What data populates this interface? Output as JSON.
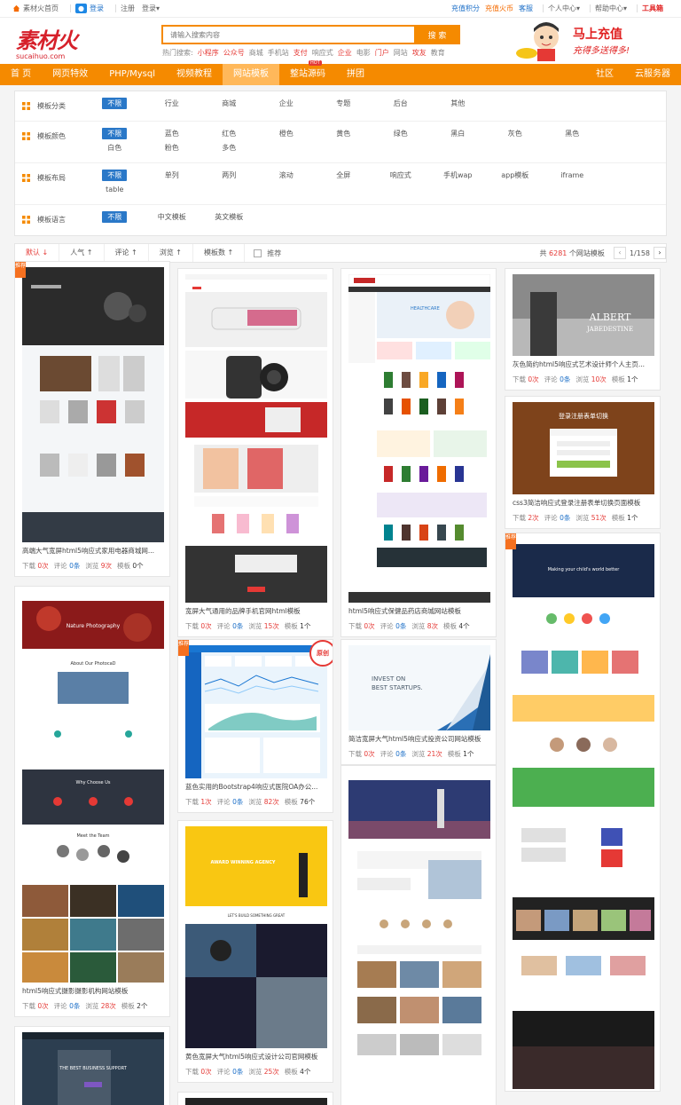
{
  "topbar": {
    "home": "素材火首页",
    "login": "登录",
    "register": "注册",
    "login_menu": "登录",
    "recharge_points": "充值积分",
    "recharge_fire": "充值火币",
    "vip": "客服",
    "personal": "个人中心",
    "help": "帮助中心",
    "tools": "工具箱"
  },
  "header": {
    "logo": "素材火",
    "logo_sub": "sucaihuo.com",
    "search_placeholder": "请输入搜索内容",
    "search_button": "搜 索",
    "hot_label": "热门搜索:",
    "hot": [
      "小程序",
      "公众号",
      "商城",
      "手机站",
      "支付",
      "响应式",
      "企业",
      "电影",
      "门户",
      "网站",
      "攻友",
      "教育"
    ],
    "promo_line1": "马上充值",
    "promo_line2": "充得多送得多!"
  },
  "nav": {
    "items": [
      "首 页",
      "网页特效",
      "PHP/Mysql",
      "视频教程",
      "网站模板",
      "整站源码",
      "拼团"
    ],
    "right": [
      "社区",
      "云服务器"
    ],
    "hot_tag": "HOT"
  },
  "filters": [
    {
      "label": "模板分类",
      "options": [
        "不限",
        "行业",
        "商城",
        "企业",
        "专题",
        "后台",
        "其他"
      ]
    },
    {
      "label": "模板颜色",
      "options": [
        "不限",
        "蓝色",
        "红色",
        "橙色",
        "黄色",
        "绿色",
        "黑白",
        "灰色",
        "黑色",
        "白色",
        "粉色",
        "多色"
      ]
    },
    {
      "label": "模板布局",
      "options": [
        "不限",
        "单列",
        "两列",
        "滚动",
        "全屏",
        "响应式",
        "手机wap",
        "app模板",
        "iframe",
        "table"
      ]
    },
    {
      "label": "模板语言",
      "options": [
        "不限",
        "中文模板",
        "英文模板"
      ]
    }
  ],
  "sortbar": {
    "items": [
      "默认",
      "人气",
      "评论",
      "浏览",
      "模板数"
    ],
    "recommend": "推荐",
    "total_prefix": "共",
    "total": "6281",
    "total_suffix": "个网站模板",
    "page": "1/158"
  },
  "cards": [
    {
      "title": "高端大气宽屏html5响应式家用电器商城网...",
      "down": "0次",
      "comment": "0条",
      "view": "9次",
      "tpl": "0个",
      "badge": "推荐"
    },
    {
      "title": "宽屏大气通用的品牌手机官网html模板",
      "down": "0次",
      "comment": "0条",
      "view": "15次",
      "tpl": "1个"
    },
    {
      "title": "html5响应式保健品药店商城网站模板",
      "down": "0次",
      "comment": "0条",
      "view": "8次",
      "tpl": "4个"
    },
    {
      "title": "灰色简约html5响应式艺术设计师个人主页...",
      "down": "0次",
      "comment": "0条",
      "view": "10次",
      "tpl": "1个"
    },
    {
      "title": "css3简洁响应式登录注册表单切换页面模板",
      "down": "2次",
      "comment": "0条",
      "view": "51次",
      "tpl": "1个"
    },
    {
      "title": "html5响应式摄影摄影机构网站模板",
      "down": "0次",
      "comment": "0条",
      "view": "28次",
      "tpl": "2个"
    },
    {
      "title": "蓝色实用的Bootstrap4响应式医院OA办公...",
      "down": "1次",
      "comment": "0条",
      "view": "82次",
      "tpl": "76个",
      "badge": "推荐",
      "badge2": "原创"
    },
    {
      "title": "简洁宽屏大气html5响应式投资公司网站模板",
      "down": "0次",
      "comment": "0条",
      "view": "21次",
      "tpl": "1个"
    },
    {
      "title": "黄色宽屏大气html5响应式设计公司官网模板",
      "down": "0次",
      "comment": "0条",
      "view": "25次",
      "tpl": "4个"
    }
  ],
  "stats_labels": {
    "down": "下载",
    "comment": "评论",
    "view": "浏览",
    "tpl": "模板"
  },
  "thumbs": {
    "albert": "ALBERT",
    "albert_sub": "JABEDESTINE",
    "login_title": "登录注册表单切换",
    "invest1": "INVEST ON",
    "invest2": "BEST STARTUPS.",
    "award": "AWARD WINNING AGENCY",
    "nature": "Nature Photography",
    "about": "About Our PhotocaD",
    "why": "Why Choose Us",
    "team": "Meet the Team",
    "making": "Making your child's world better",
    "healthcare": "HEALTHCARE",
    "business": "THE BEST BUSINESS SUPPORT",
    "lets_build": "LET'S BUILD SOMETHING GREAT"
  },
  "colors": {
    "orange": "#f58a00",
    "blue": "#2a78c8",
    "red": "#e53935"
  }
}
